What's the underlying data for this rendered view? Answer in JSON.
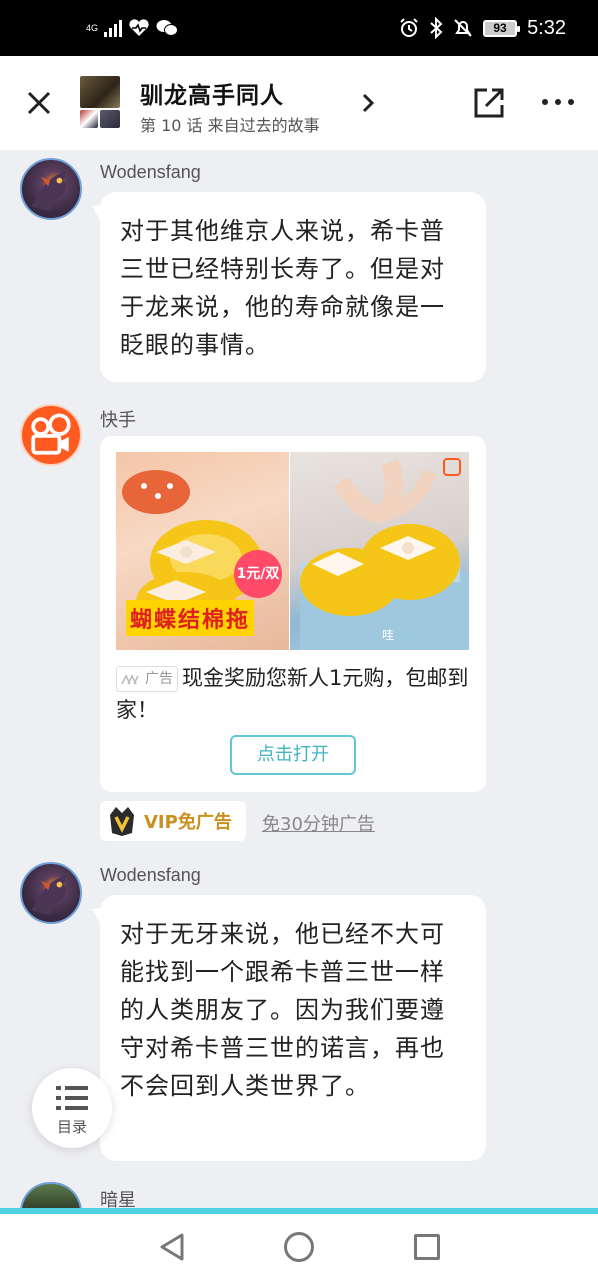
{
  "status_bar": {
    "network": "4G",
    "battery": "93",
    "time": "5:32"
  },
  "header": {
    "book_title": "驯龙高手同人",
    "chapter": "第 10 话 来自过去的故事"
  },
  "messages": [
    {
      "sender": "Wodensfang",
      "text": "对于其他维京人来说，希卡普三世已经特别长寿了。但是对于龙来说，他的寿命就像是一眨眼的事情。"
    },
    {
      "sender": "快手",
      "ad": {
        "image_caption": "蝴蝶结棉拖",
        "price_badge": "1元/双",
        "image_sticker": "哇",
        "tag": "广告",
        "text": "现金奖励您新人1元购，包邮到家！",
        "button": "点击打开"
      }
    },
    {
      "sender": "Wodensfang",
      "text": "对于无牙来说，他已经不大可能找到一个跟希卡普三世一样的人类朋友了。因为我们要遵守对希卡普三世的诺言，再也不会回到人类世界了。"
    },
    {
      "sender": "暗星"
    }
  ],
  "vip": {
    "label": "VIP免广告",
    "free_link": "免30分钟广告"
  },
  "toc": {
    "label": "目录"
  },
  "colors": {
    "accent": "#4fd2e2",
    "button_border": "#5fc8d4",
    "vip_gold": "#c8901e",
    "background": "#eeeff3"
  }
}
